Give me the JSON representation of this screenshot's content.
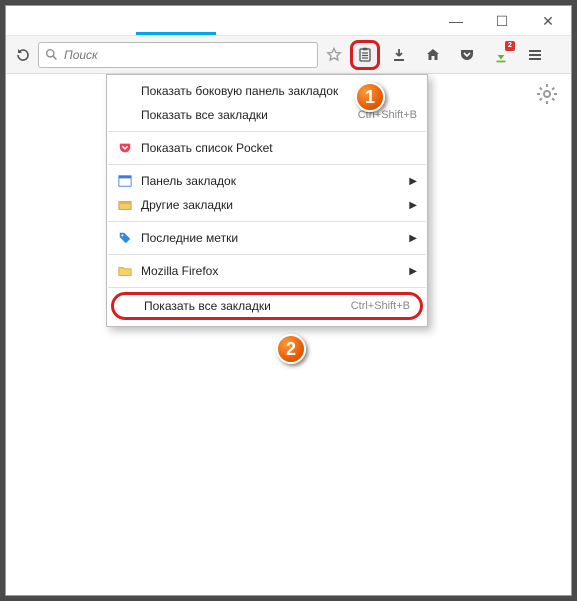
{
  "window": {
    "minimize_glyph": "—",
    "maximize_glyph": "☐",
    "close_glyph": "✕"
  },
  "toolbar": {
    "search_placeholder": "Поиск",
    "downloads_badge": "2"
  },
  "menu": {
    "items": [
      {
        "label": "Показать боковую панель закладок",
        "shortcut": ""
      },
      {
        "label": "Показать все закладки",
        "shortcut": "Ctrl+Shift+B"
      }
    ],
    "pocket_label": "Показать список Pocket",
    "panel_label": "Панель закладок",
    "other_label": "Другие закладки",
    "recent_label": "Последние метки",
    "firefox_label": "Mozilla Firefox",
    "show_all_label": "Показать все закладки",
    "show_all_shortcut": "Ctrl+Shift+B"
  },
  "steps": {
    "one": "1",
    "two": "2"
  }
}
